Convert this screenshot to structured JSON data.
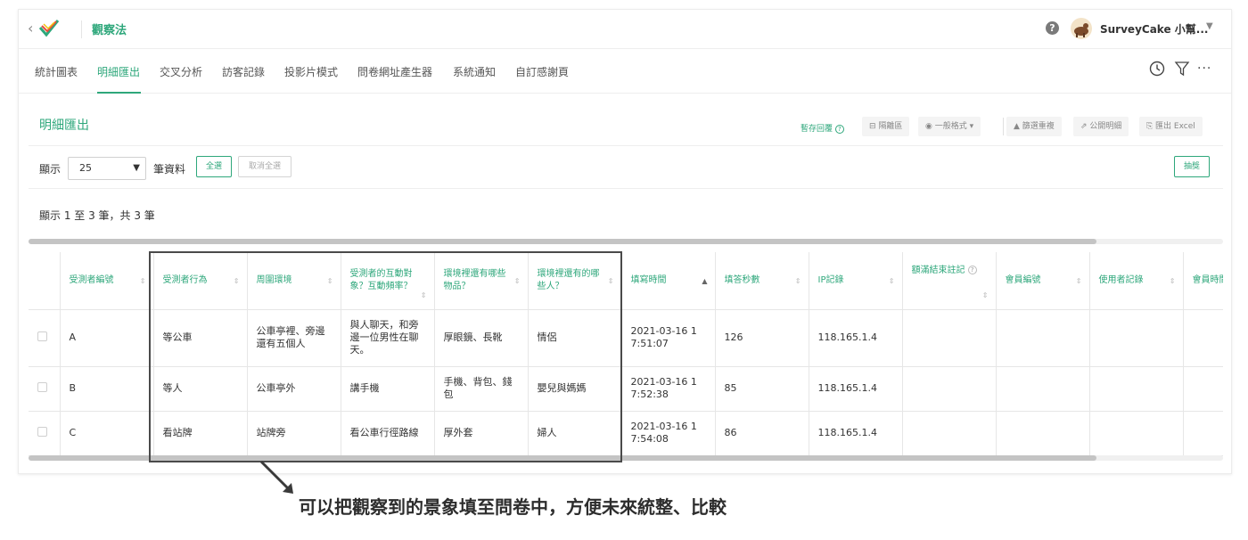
{
  "header": {
    "back_icon": "chevron-left-icon",
    "logo_icon": "surveycake-logo-icon",
    "survey_title": "觀察法",
    "help_icon": "question-circle-icon",
    "user_name": "SurveyCake 小幫...",
    "user_caret_icon": "caret-down-icon"
  },
  "tabs": [
    {
      "label": "統計圖表"
    },
    {
      "label": "明細匯出",
      "active": true
    },
    {
      "label": "交叉分析"
    },
    {
      "label": "訪客記錄"
    },
    {
      "label": "投影片模式"
    },
    {
      "label": "問卷網址產生器"
    },
    {
      "label": "系統通知"
    },
    {
      "label": "自訂感謝頁"
    }
  ],
  "tab_tools": {
    "clock_icon": "clock-icon",
    "filter_icon": "filter-icon",
    "more_label": "···"
  },
  "section": {
    "title": "明細匯出",
    "save_reply": "暫存回覆",
    "tools": {
      "isolate": "⊟ 隔離區",
      "format": "◉ 一般格式 ▾",
      "dedupe": "▲ 篩選重複",
      "public": "⇗ 公開明細",
      "export": "⎘ 匯出 Excel"
    }
  },
  "controls": {
    "show_label": "顯示",
    "page_size": "25",
    "records_label": "筆資料",
    "select_all": "全選",
    "deselect_all": "取消全選",
    "lottery": "抽獎",
    "summary": "顯示 1 至 3 筆，共 3 筆"
  },
  "table": {
    "headers": [
      "受測者編號",
      "受測者行為",
      "周圍環境",
      "受測者的互動對象？互動頻率？",
      "環境裡還有哪些物品？",
      "環境裡還有的哪些人？",
      "填寫時間",
      "填答秒數",
      "IP記錄",
      "額滿結束註記",
      "會員編號",
      "使用者記錄",
      "會員時間"
    ],
    "rows": [
      [
        "A",
        "等公車",
        "公車亭裡、旁邊還有五個人",
        "與人聊天，和旁邊一位男性在聊天。",
        "厚眼鏡、長靴",
        "情侶",
        "2021-03-16 17:51:07",
        "126",
        "118.165.1.4",
        "",
        "",
        "",
        ""
      ],
      [
        "B",
        "等人",
        "公車亭外",
        "講手機",
        "手機、背包、錢包",
        "嬰兒與媽媽",
        "2021-03-16 17:52:38",
        "85",
        "118.165.1.4",
        "",
        "",
        "",
        ""
      ],
      [
        "C",
        "看站牌",
        "站牌旁",
        "看公車行徑路線",
        "厚外套",
        "婦人",
        "2021-03-16 17:54:08",
        "86",
        "118.165.1.4",
        "",
        "",
        "",
        ""
      ]
    ]
  },
  "annotation": {
    "text": "可以把觀察到的景象填至問卷中，方便未來統整、比較"
  }
}
